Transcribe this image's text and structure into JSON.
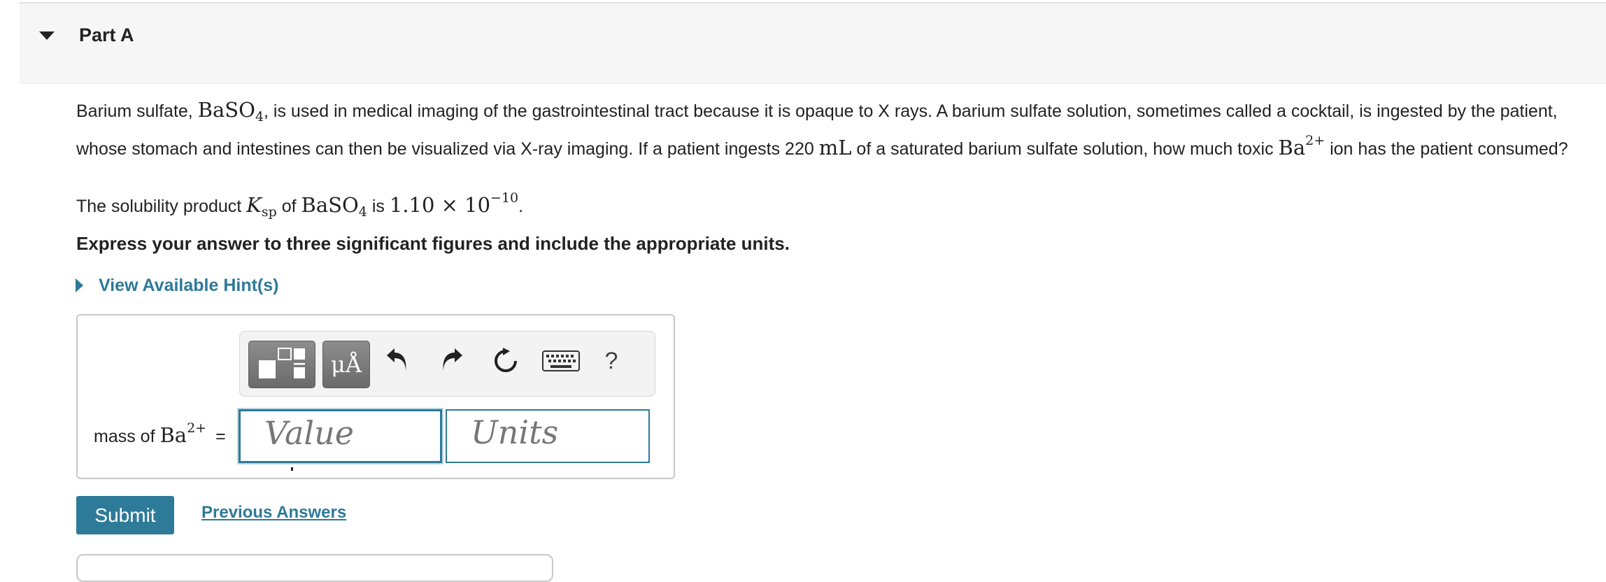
{
  "part": {
    "title": "Part A"
  },
  "question": {
    "intro_1": "Barium sulfate, ",
    "intro_2": ", is used in medical imaging of the gastrointestinal tract because it is opaque to X rays. A barium sulfate solution, sometimes called a cocktail, is ingested by the patient, whose stomach and intestines can then be visualized via X-ray imaging. If a patient ingests 220 ",
    "intro_3": " of a saturated barium sulfate solution, how much toxic ",
    "intro_4": " ion has the patient consumed?",
    "formula_base": "BaSO",
    "formula_sub": "4",
    "volume_unit": "mL",
    "ion": "Ba",
    "ion_charge": "2+"
  },
  "solubility": {
    "text_1": "The solubility product ",
    "ksp_k": "K",
    "ksp_sub": "sp",
    "text_2": " of ",
    "text_3": " is ",
    "value_mantissa": "1.10 × 10",
    "value_exponent": "−10",
    "period": "."
  },
  "instruction": "Express your answer to three significant figures and include the appropriate units.",
  "hint": {
    "label": "View Available Hint(s)"
  },
  "toolbar": {
    "units_button": "μÅ",
    "help_label": "?",
    "icons": [
      "templates-icon",
      "undo-icon",
      "redo-icon",
      "reset-icon",
      "keyboard-icon",
      "help-icon"
    ]
  },
  "answer": {
    "label_prefix": "mass of ",
    "label_ion": "Ba",
    "label_charge": "2+",
    "equals": "=",
    "value_placeholder": "Value",
    "units_placeholder": "Units"
  },
  "actions": {
    "submit": "Submit",
    "previous": "Previous Answers"
  },
  "colors": {
    "accent": "#2e7a99",
    "header_bg": "#f6f6f6"
  }
}
